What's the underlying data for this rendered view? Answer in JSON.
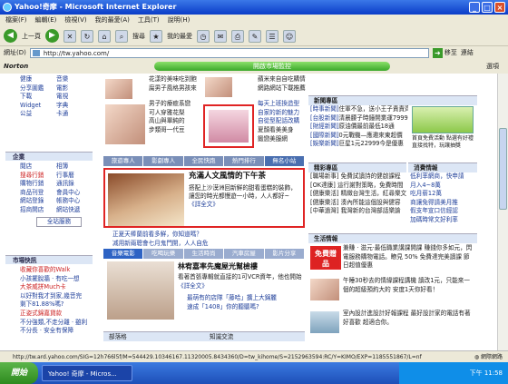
{
  "window": {
    "title": "Yahoo!奇摩 - Microsoft Internet Explorer"
  },
  "menubar": [
    "檔案(F)",
    "編輯(E)",
    "檢視(V)",
    "我的最愛(A)",
    "工具(T)",
    "說明(H)"
  ],
  "toolbar": {
    "back": "上一頁",
    "search": "搜尋",
    "favorites": "我的最愛"
  },
  "address": {
    "label": "網址(D)",
    "url": "http://tw.yahoo.com/",
    "go": "移至",
    "links": "連結"
  },
  "norton": {
    "logo": "Norton",
    "center": "開啟市場監控",
    "options": "選項"
  },
  "left_categories": {
    "col1": [
      "健康",
      "分享圖鑑",
      "下載",
      "Widget",
      "公益"
    ],
    "col2": [
      "音樂",
      "電影",
      "電視",
      "字典",
      "卡通"
    ]
  },
  "enterprise": {
    "header": "企業",
    "col1": [
      "閱店",
      "搜尋行銷",
      "購物行銷",
      "商品刊登",
      "網站登錄",
      "招商開店"
    ],
    "col2": [
      "相簿",
      "行事曆",
      "通訊錄",
      "會員中心",
      "帳務中心",
      "網站快遞"
    ],
    "all": "全站服務"
  },
  "sponsor": {
    "header": "市場快訊",
    "items": [
      "收藏你喜歡的Walk",
      "小孩擺脫牆 · 有吃一想",
      "大茶威拼Much卡",
      "以好對我才到家,幾音完",
      "剩下81.88%嗎?",
      "正姿式錦嘉貸款",
      "不分強類,不走分離 · 雖利",
      "不分長 · 安全有保障"
    ]
  },
  "topnews": {
    "left_items": [
      "花漾的美味吃到飽",
      "腐男子風格男孩來",
      "男子的療癒系戀",
      "可人穿雅花梨",
      "高山與單純的",
      "步類哥一代豆"
    ],
    "right_items": [
      "蘋米來自自吃購情",
      "網路網站下載推薦",
      "每天上班換造型",
      "自家的新的魅力",
      "自從型配話改購",
      "夏顏看美美身",
      "鍛戀美服網"
    ]
  },
  "tabs": [
    "旅遊專人",
    "影劇專人",
    "全民快跑",
    "熱門排行",
    "無名小站"
  ],
  "featured": {
    "title": "充滿人文風情的下午茶",
    "desc": "搭配上沙漠洲回新鮮的甜看蛋糕的裝飾，讓您的時光都慢遊一小時，人人都好~",
    "more": "《詳全文》",
    "links": [
      "正夏天棒蘭前看多鮮，你知道嗎？",
      "减用新兩聰會七月鬼門開，人人自危"
    ]
  },
  "tabs2": [
    "音樂電影",
    "吃喝玩樂",
    "生活時尚",
    "汽車房屋",
    "影片分享"
  ],
  "person": {
    "title": "林宥嘉率先魔屋光幫檢樓",
    "desc": "看著首張專輯就直接的1可VCR資年，他也開始",
    "more": "《詳全文》",
    "links": [
      "最萌有的店隊「藤哈」擴上大錦麗",
      "速成「1408」你的聽聽嗎?"
    ]
  },
  "bottom_headers": [
    "部落格",
    "知識交流"
  ],
  "right_news": {
    "header": "新聞專區",
    "items": [
      {
        "tag": "[時事新聞]",
        "text": "住軍不急，送小王子責責齊"
      },
      {
        "tag": "[台股新聞]",
        "text": "清晨腰子時鐘開業運7999"
      },
      {
        "tag": "[財經新聞]",
        "text": "原油價最前最低18通"
      },
      {
        "tag": "[國際新聞]",
        "text": "0元戰機—應邀來東超價"
      },
      {
        "tag": "[娛樂新聞]",
        "text": "巨星1元22999今是優惠"
      }
    ],
    "ad_text": "首頁免費活動 點選有好禮 直接找特，玩讓抽獎"
  },
  "right_boxes": [
    {
      "header": "精彩專區",
      "items": [
        "[職場新事] 免費試讀詩的健啟課程",
        "[OK達康] 這行謝對策略，免費時間",
        "[健康樂活] 精緻台灣生活，紅尋樂文",
        "[健康樂活] 湊內所能這個設與健容",
        "[中華過灣] 我灣新的台灣部話樂論"
      ]
    },
    {
      "header": "消費情報",
      "items": [
        "低利率網商，快申請",
        "月入4~8萬",
        "吃月薪12萬",
        "商讓免得請美月推",
        "假支年宣口信經認",
        "加碼時常文好利率"
      ]
    }
  ],
  "life": {
    "header": "生活情報",
    "items": [
      {
        "badge": "免費贈品",
        "text": "兼賺 · 滋元·最低職業講課開課 賺錢你多如元，閃電服務購物電話。瞭見 50% 免費達完美讀課 節日超值優惠"
      },
      {
        "badge": "",
        "text": "午睡30秒去的情緣課程講機 讀改1元，只能來一個的超級預約大的 安度1天你好看！"
      },
      {
        "badge": "",
        "text": "室內設計進設計好報課程 最好設計家的電話有著好喜歡 超適合你。"
      }
    ]
  },
  "status": {
    "url": "http://tw.ard.yahoo.com/SIG=12h766l5f/M=544429.10346167.11320005.8434360/D=tw_kihome/S=2152963594:RC/Y=KIMO/EXP=1185551867/L=nf",
    "zone": "網際網路"
  },
  "taskbar": {
    "start": "開始",
    "item": "Yahoo! 奇摩 - Micros...",
    "time": "下午 11:58"
  },
  "colors": {
    "accent": "#2e63c4",
    "highlight": "#e02424"
  }
}
